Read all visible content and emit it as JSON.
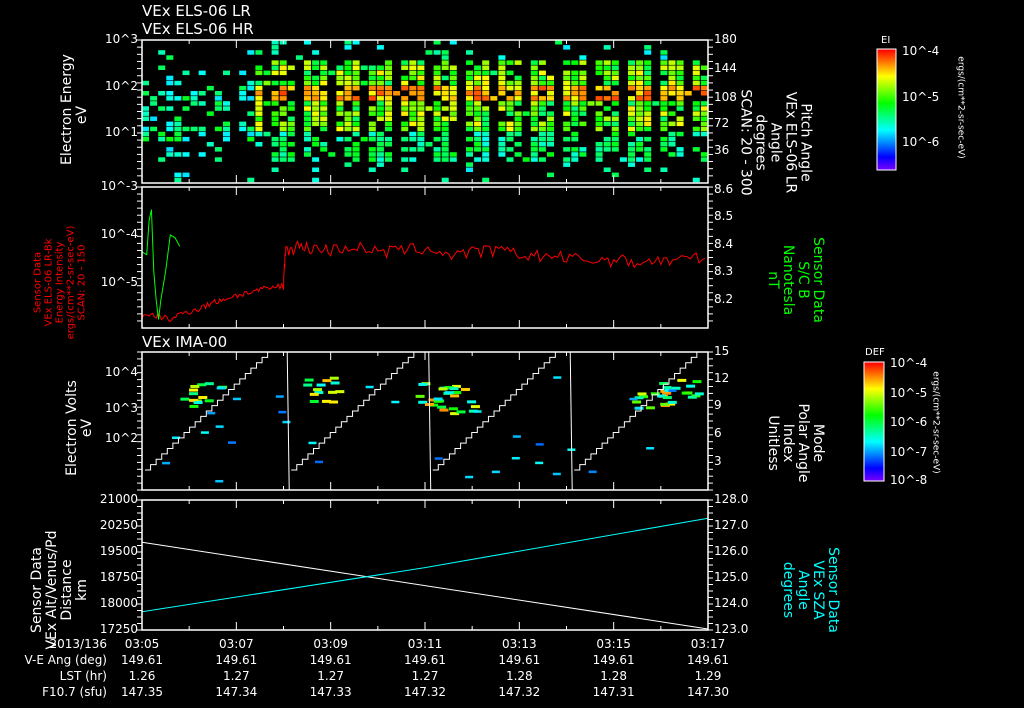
{
  "titles": {
    "panel1_a": "VEx ELS-06 LR",
    "panel1_b": "VEx ELS-06 HR",
    "panel3": "VEx IMA-00"
  },
  "colors": {
    "red": "#ff0000",
    "green": "#00ff00",
    "cyan": "#00ffff",
    "white": "#ffffff"
  },
  "chart_data": [
    {
      "type": "heatmap",
      "title": "VEx ELS-06 LR / HR",
      "ylabel": [
        "Electron Energy",
        "eV"
      ],
      "yticks": [
        "10^1",
        "10^2",
        "10^3"
      ],
      "right_label": [
        "Pitch Angle",
        "VEx ELS-06 LR",
        "Angle",
        "degrees",
        "SCAN: 20 - 300"
      ],
      "right_ticks": [
        "180",
        "144",
        "108",
        "72",
        "36"
      ],
      "colorbar": {
        "label": "EI",
        "ticks": [
          "10^-4",
          "10^-5",
          "10^-6"
        ],
        "units": "ergs/(cm**2-sr-sec-eV)"
      }
    },
    {
      "type": "line",
      "left_label": [
        "Sensor Data",
        "VEx ELS-06 LR-Bk",
        "Energy Intensity",
        "ergs/(cm**2-sr-sec-eV)",
        "SCAN: 20 - 150"
      ],
      "left_ticks": [
        "10^-3",
        "10^-4",
        "10^-5"
      ],
      "right_label": [
        "Sensor Data",
        "S/C B",
        "Nanotesla",
        "nT"
      ],
      "right_ticks": [
        "8.6",
        "8.5",
        "8.4",
        "8.3",
        "8.2"
      ],
      "ylim_left": [
        1.2e-06,
        0.001
      ],
      "ylim_right": [
        8.1,
        8.6
      ],
      "series": [
        {
          "name": "Energy Intensity",
          "color": "red",
          "x": [
            0,
            0.3,
            0.6,
            0.9,
            1.2,
            1.5,
            1.8,
            2.1,
            2.4,
            2.7,
            3.0,
            3.05,
            3.3,
            3.6,
            4,
            4.5,
            5,
            5.5,
            6,
            6.5,
            7,
            7.5,
            8,
            8.5,
            9,
            9.5,
            10,
            10.5,
            11,
            11.5,
            12
          ],
          "y": [
            2e-06,
            2.2e-06,
            1.8e-06,
            2.5e-06,
            3e-06,
            4e-06,
            5e-06,
            6e-06,
            7e-06,
            8e-06,
            9e-06,
            5e-05,
            6e-05,
            5.5e-05,
            5e-05,
            6e-05,
            4.5e-05,
            5e-05,
            5.5e-05,
            4e-05,
            4.5e-05,
            5e-05,
            4e-05,
            3.8e-05,
            3.5e-05,
            3e-05,
            3.2e-05,
            2.8e-05,
            3e-05,
            3.2e-05,
            3.5e-05
          ]
        },
        {
          "name": "S/C B",
          "color": "green",
          "x": [
            0,
            0.1,
            0.15,
            0.2,
            0.25,
            0.3,
            0.35,
            0.4,
            0.5,
            0.6,
            0.7,
            0.8
          ],
          "y": [
            8.37,
            8.36,
            8.48,
            8.52,
            8.3,
            8.2,
            8.13,
            8.2,
            8.3,
            8.43,
            8.42,
            8.39
          ]
        }
      ]
    },
    {
      "type": "heatmap",
      "title": "VEx IMA-00",
      "ylabel": [
        "Electron Volts",
        "eV"
      ],
      "yticks": [
        "10^2",
        "10^3",
        "10^4"
      ],
      "right_label": [
        "Mode",
        "Polar Angle",
        "Index",
        "Unitless"
      ],
      "right_ticks": [
        "15",
        "12",
        "9",
        "6",
        "3"
      ],
      "colorbar": {
        "label": "DEF",
        "ticks": [
          "10^-4",
          "10^-5",
          "10^-6",
          "10^-7",
          "10^-8"
        ],
        "units": "ergs/(cm**2-sr-sec-eV)"
      }
    },
    {
      "type": "line",
      "left_label": [
        "Sensor Data",
        "VEx Alt/Venus/Pd",
        "Distance",
        "km"
      ],
      "left_ticks": [
        "21000",
        "20250",
        "19500",
        "18750",
        "18000",
        "17250"
      ],
      "right_label": [
        "Sensor Data",
        "VEx SZA",
        "Angle",
        "degrees"
      ],
      "right_ticks": [
        "128.0",
        "127.0",
        "126.0",
        "125.0",
        "124.0",
        "123.0"
      ],
      "ylim_left": [
        17250,
        21000
      ],
      "ylim_right": [
        123,
        128
      ],
      "series": [
        {
          "name": "Distance",
          "color": "white",
          "x": [
            0,
            12
          ],
          "y": [
            19780,
            17280
          ]
        },
        {
          "name": "SZA",
          "color": "cyan",
          "x": [
            0,
            6,
            12
          ],
          "y": [
            123.7,
            125.4,
            127.3
          ]
        }
      ]
    }
  ],
  "footer": {
    "labels": [
      "2013/136",
      "V-E Ang (deg)",
      "LST (hr)",
      "F10.7 (sfu)"
    ],
    "times": [
      "03:05",
      "03:07",
      "03:09",
      "03:11",
      "03:13",
      "03:15",
      "03:17"
    ],
    "ve_ang": [
      "149.61",
      "149.61",
      "149.61",
      "149.61",
      "149.61",
      "149.61",
      "149.61"
    ],
    "lst": [
      "1.26",
      "1.27",
      "1.27",
      "1.27",
      "1.28",
      "1.28",
      "1.29"
    ],
    "f107": [
      "147.35",
      "147.34",
      "147.33",
      "147.32",
      "147.32",
      "147.31",
      "147.30"
    ]
  }
}
